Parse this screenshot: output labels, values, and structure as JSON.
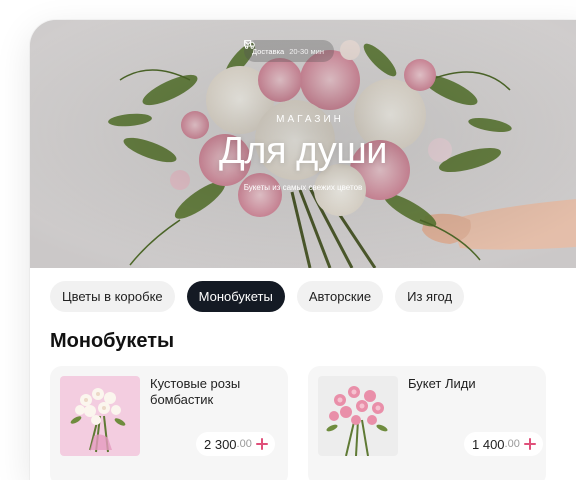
{
  "delivery": {
    "label": "Доставка",
    "time": "20-30 мин"
  },
  "hero": {
    "eyebrow": "МАГАЗИН",
    "title": "Для души",
    "subtitle": "Букеты из самых свежих цветов"
  },
  "categories": [
    {
      "label": "Цветы в коробке",
      "active": false
    },
    {
      "label": "Монобукеты",
      "active": true
    },
    {
      "label": "Авторские",
      "active": false
    },
    {
      "label": "Из ягод",
      "active": false
    }
  ],
  "section": {
    "title": "Монобукеты"
  },
  "products": [
    {
      "name": "Кустовые розы бомбастик",
      "price_main": "2 300",
      "price_cents": ".00"
    },
    {
      "name": "Букет Лиди",
      "price_main": "1 400",
      "price_cents": ".00"
    }
  ],
  "colors": {
    "accent": "#e0507a",
    "chip_active": "#141a24",
    "chip": "#f1f1f1"
  },
  "icons": {
    "delivery": "truck-icon",
    "dropdown": "chevron-down-icon",
    "add": "plus-icon"
  }
}
